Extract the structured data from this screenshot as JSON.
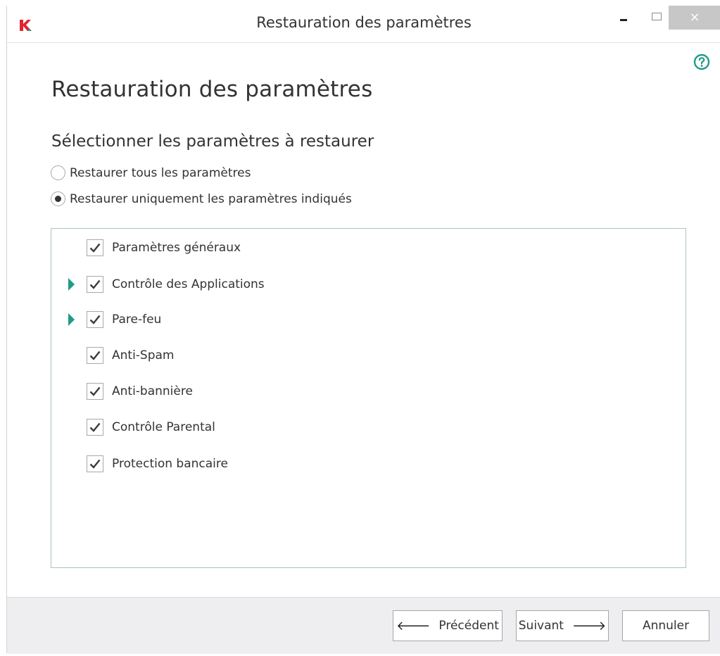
{
  "window": {
    "title": "Restauration des paramètres",
    "close_glyph": "×"
  },
  "header": {
    "title": "Restauration des paramètres",
    "subtitle": "Sélectionner les paramètres à restaurer",
    "help_icon": "question-circle-icon"
  },
  "options": [
    {
      "label": "Restaurer tous les paramètres",
      "selected": false
    },
    {
      "label": "Restaurer uniquement les paramètres indiqués",
      "selected": true
    }
  ],
  "settings_list": [
    {
      "label": "Paramètres généraux",
      "checked": true,
      "expandable": false
    },
    {
      "label": "Contrôle des Applications",
      "checked": true,
      "expandable": true
    },
    {
      "label": "Pare-feu",
      "checked": true,
      "expandable": true
    },
    {
      "label": "Anti-Spam",
      "checked": true,
      "expandable": false
    },
    {
      "label": "Anti-bannière",
      "checked": true,
      "expandable": false
    },
    {
      "label": "Contrôle Parental",
      "checked": true,
      "expandable": false
    },
    {
      "label": "Protection bancaire",
      "checked": true,
      "expandable": false
    }
  ],
  "footer": {
    "prev_label": "Précédent",
    "next_label": "Suivant",
    "cancel_label": "Annuler",
    "prev_arrow": "🡐",
    "next_arrow": "🡒"
  },
  "colors": {
    "accent": "#1f9b86",
    "logo_red": "#e0262f",
    "close_button": "#c7c7c7"
  }
}
